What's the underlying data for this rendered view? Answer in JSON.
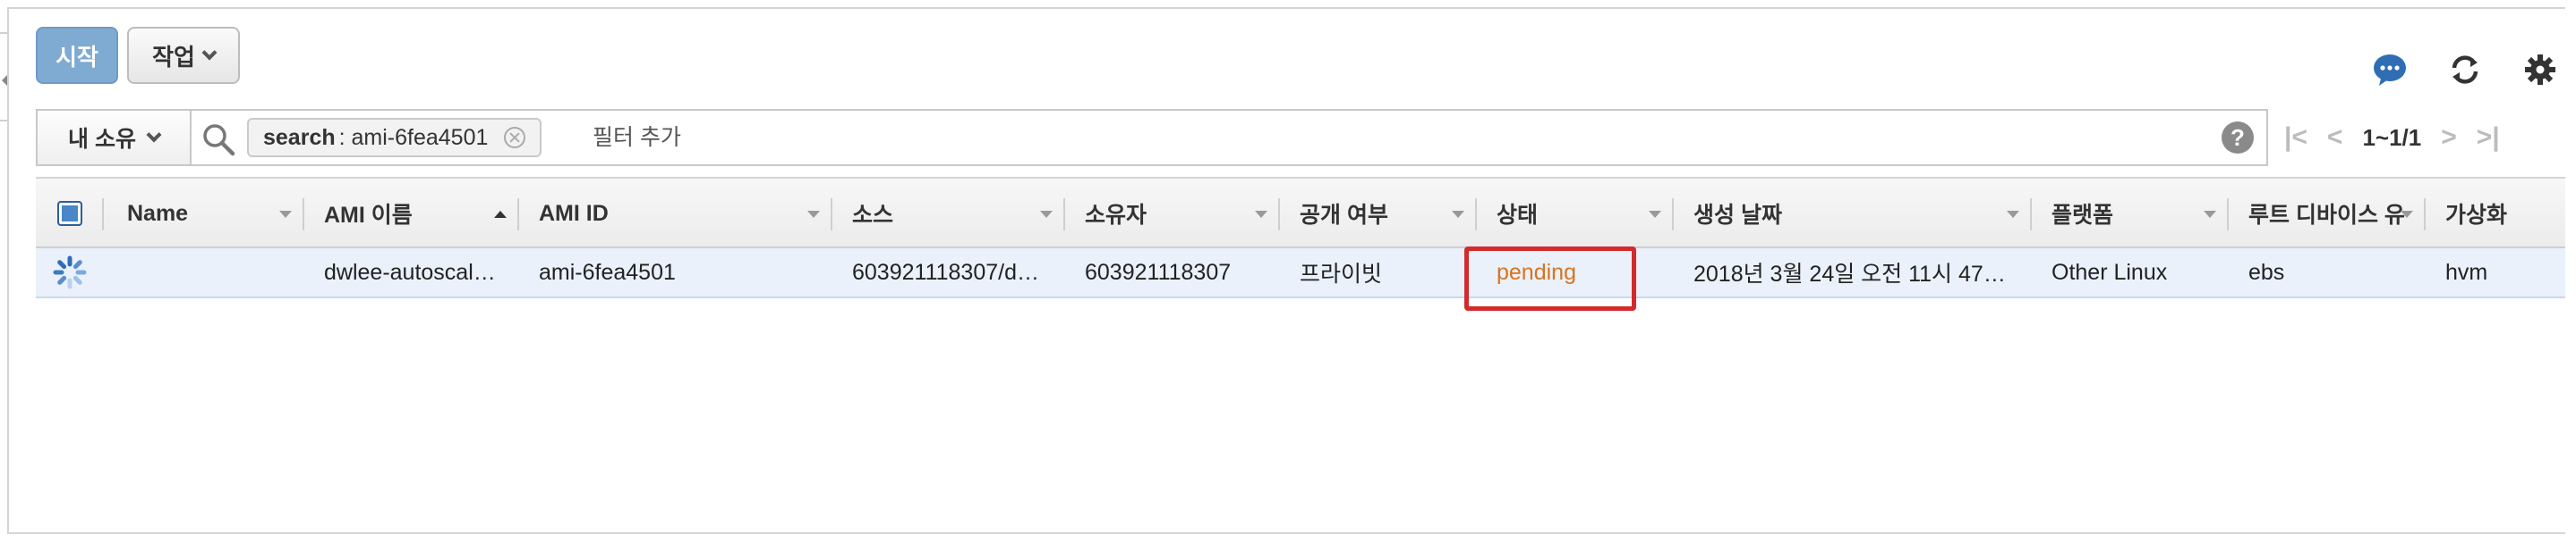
{
  "toolbar": {
    "start_label": "시작",
    "action_label": "작업"
  },
  "top_icons": [
    "chat-icon",
    "refresh-icon",
    "gear-icon"
  ],
  "filter": {
    "owner_label": "내 소유",
    "chip_key": "search",
    "chip_value": ": ami-6fea4501",
    "placeholder": "필터 추가",
    "help": "?"
  },
  "pager": {
    "range": "1~1/1"
  },
  "table": {
    "columns": [
      "Name",
      "AMI 이름",
      "AMI ID",
      "소스",
      "소유자",
      "공개 여부",
      "상태",
      "생성 날짜",
      "플랫폼",
      "루트 디바이스 유",
      "가상화"
    ],
    "rows": [
      {
        "name": "",
        "ami_name": "dwlee-autoscal…",
        "ami_id": "ami-6fea4501",
        "source": "603921118307/d…",
        "owner": "603921118307",
        "visibility": "프라이빗",
        "status": "pending",
        "created": "2018년 3월 24일 오전 11시 47…",
        "platform": "Other Linux",
        "root_device": "ebs",
        "virtualization": "hvm"
      }
    ]
  },
  "colors": {
    "start_button": "#7faad1",
    "status_pending": "#d9731e",
    "highlight_box": "#d12b2b",
    "selected_row": "#eaf1fa"
  }
}
